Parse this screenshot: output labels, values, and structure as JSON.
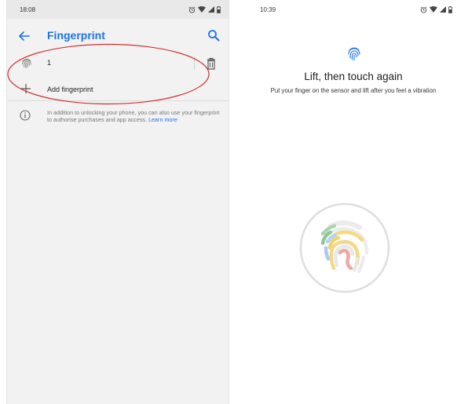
{
  "left_screen": {
    "status_time": "18:08",
    "title": "Fingerprint",
    "fingerprint_item": {
      "name": "1"
    },
    "add_label": "Add fingerprint",
    "info_text": "In addition to unlocking your phone, you can also use your fingerprint to authorise purchases and app access.",
    "learn_more": "Learn more"
  },
  "right_screen": {
    "status_time": "10:39",
    "headline": "Lift, then touch again",
    "instruction": "Put your finger on the sensor and lift after you feel a vibration"
  },
  "colors": {
    "accent": "#1a73e8",
    "annotation": "#d32f2f"
  },
  "icons": [
    "back-arrow-icon",
    "search-icon",
    "fingerprint-icon",
    "trash-icon",
    "plus-icon",
    "info-icon",
    "alarm-icon",
    "wifi-icon",
    "signal-icon",
    "battery-icon"
  ]
}
